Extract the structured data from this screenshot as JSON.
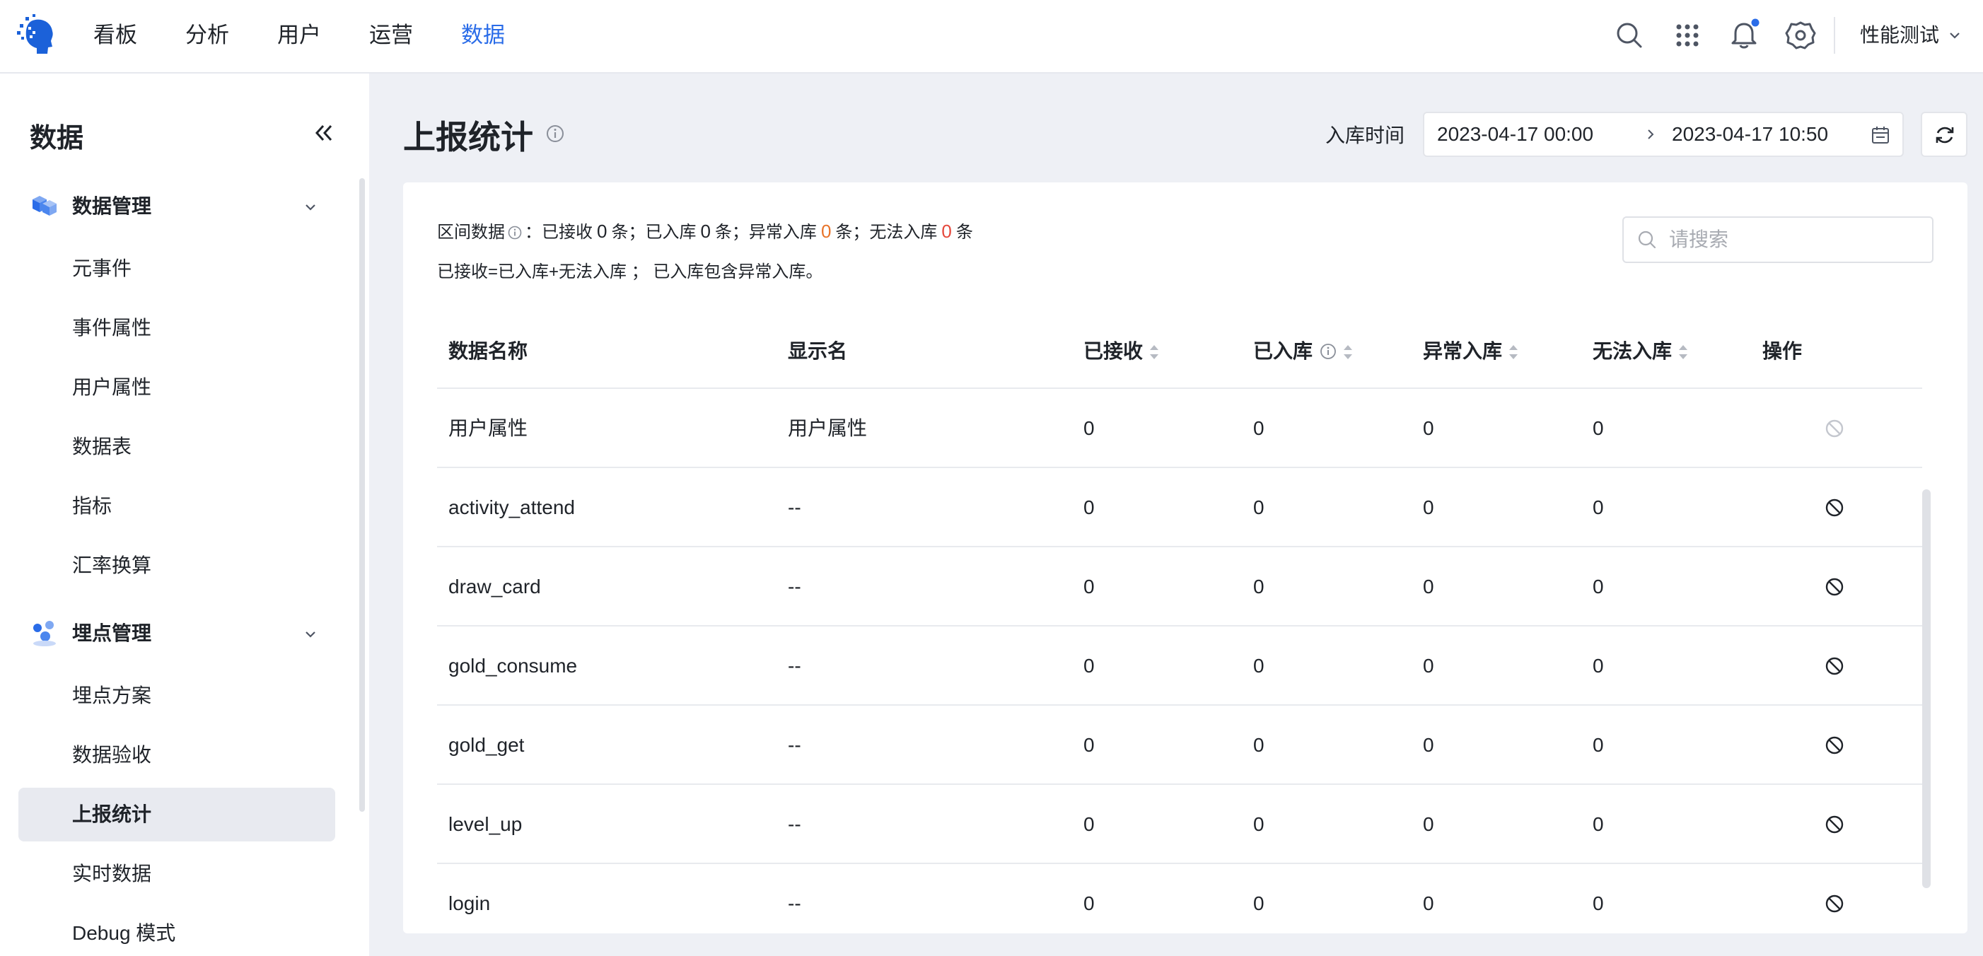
{
  "app": {
    "nav": [
      "看板",
      "分析",
      "用户",
      "运营",
      "数据"
    ],
    "active_nav_index": 4,
    "user_name": "性能测试",
    "accent_color": "#2a6ce8",
    "icons": [
      "logo",
      "search-icon",
      "apps-grid-icon",
      "bell-icon",
      "gear-icon"
    ]
  },
  "sidebar": {
    "title": "数据",
    "groups": [
      {
        "label": "数据管理",
        "items": [
          "元事件",
          "事件属性",
          "用户属性",
          "数据表",
          "指标",
          "汇率换算"
        ]
      },
      {
        "label": "埋点管理",
        "items": [
          "埋点方案",
          "数据验收",
          "上报统计",
          "实时数据",
          "Debug 模式"
        ]
      }
    ],
    "active_item": "上报统计"
  },
  "main": {
    "title": "上报统计",
    "date_label": "入库时间",
    "date_start": "2023-04-17 00:00",
    "date_end": "2023-04-17 10:50",
    "summary": {
      "label": "区间数据",
      "colon": "：",
      "received_label": "已接收",
      "received": "0",
      "stored_label": "条；已入库",
      "stored": "0",
      "abnormal_label": "条；异常入库",
      "abnormal": "0",
      "failed_label": "条；无法入库",
      "failed": "0",
      "unit": "条",
      "formula": "已接收=已入库+无法入库 ； 已入库包含异常入库。"
    },
    "search_placeholder": "请搜索",
    "columns": [
      "数据名称",
      "显示名",
      "已接收",
      "已入库",
      "异常入库",
      "无法入库",
      "操作"
    ],
    "rows": [
      {
        "name": "用户属性",
        "display": "用户属性",
        "received": "0",
        "stored": "0",
        "abnormal": "0",
        "failed": "0",
        "action_disabled": true
      },
      {
        "name": "activity_attend",
        "display": "--",
        "received": "0",
        "stored": "0",
        "abnormal": "0",
        "failed": "0",
        "action_disabled": false
      },
      {
        "name": "draw_card",
        "display": "--",
        "received": "0",
        "stored": "0",
        "abnormal": "0",
        "failed": "0",
        "action_disabled": false
      },
      {
        "name": "gold_consume",
        "display": "--",
        "received": "0",
        "stored": "0",
        "abnormal": "0",
        "failed": "0",
        "action_disabled": false
      },
      {
        "name": "gold_get",
        "display": "--",
        "received": "0",
        "stored": "0",
        "abnormal": "0",
        "failed": "0",
        "action_disabled": false
      },
      {
        "name": "level_up",
        "display": "--",
        "received": "0",
        "stored": "0",
        "abnormal": "0",
        "failed": "0",
        "action_disabled": false
      },
      {
        "name": "login",
        "display": "--",
        "received": "0",
        "stored": "0",
        "abnormal": "0",
        "failed": "0",
        "action_disabled": false
      }
    ]
  }
}
